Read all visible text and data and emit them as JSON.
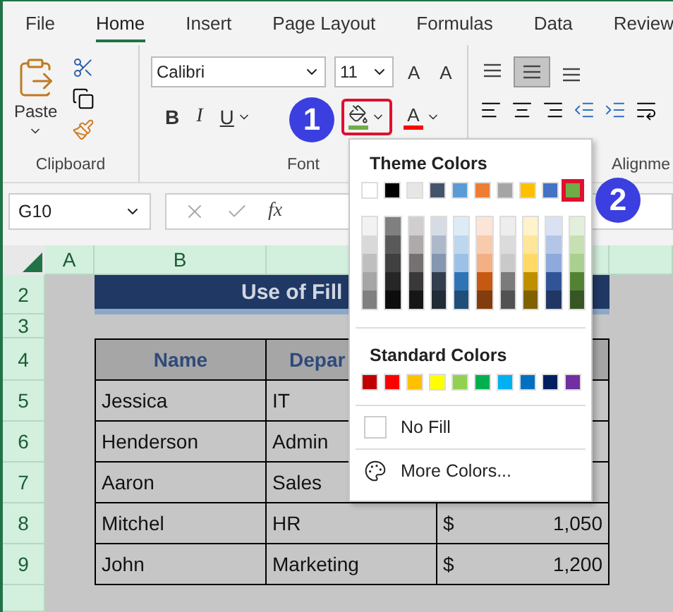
{
  "tabs": [
    {
      "label": "File",
      "selected": false
    },
    {
      "label": "Home",
      "selected": true
    },
    {
      "label": "Insert",
      "selected": false
    },
    {
      "label": "Page Layout",
      "selected": false
    },
    {
      "label": "Formulas",
      "selected": false
    },
    {
      "label": "Data",
      "selected": false
    },
    {
      "label": "Review",
      "selected": false
    }
  ],
  "clipboard": {
    "paste_label": "Paste",
    "group_label": "Clipboard"
  },
  "font": {
    "name": "Calibri",
    "size": "11",
    "grow": "A",
    "shrink": "A",
    "bold": "B",
    "italic": "I",
    "underline": "U",
    "font_color_letter": "A",
    "group_label": "Font"
  },
  "alignment": {
    "group_label": "Alignme"
  },
  "formula_bar": {
    "name_box": "G10",
    "fx": "fx"
  },
  "sheet": {
    "columns": [
      "A",
      "B"
    ],
    "row_numbers": [
      "2",
      "3",
      "4",
      "5",
      "6",
      "7",
      "8",
      "9"
    ],
    "title": "Use of Fill",
    "header": [
      "Name",
      "Depar"
    ],
    "rows": [
      [
        "Jessica",
        "IT"
      ],
      [
        "Henderson",
        "Admin"
      ],
      [
        "Aaron",
        "Sales"
      ],
      [
        "Mitchel",
        "HR",
        "$",
        "1,050"
      ],
      [
        "John",
        "Marketing",
        "$",
        "1,200"
      ]
    ]
  },
  "fill_menu": {
    "theme_title": "Theme Colors",
    "theme_colors": [
      {
        "color": "#ffffff",
        "selected": false,
        "tints": [
          {
            "color": "#f2f2f2"
          },
          {
            "color": "#d9d9d9"
          },
          {
            "color": "#bfbfbf"
          },
          {
            "color": "#a6a6a6"
          },
          {
            "color": "#808080"
          }
        ]
      },
      {
        "color": "#000000",
        "selected": false,
        "tints": [
          {
            "color": "#808080"
          },
          {
            "color": "#595959"
          },
          {
            "color": "#404040"
          },
          {
            "color": "#262626"
          },
          {
            "color": "#0d0d0d"
          }
        ]
      },
      {
        "color": "#e7e6e6",
        "selected": false,
        "tints": [
          {
            "color": "#d0cece"
          },
          {
            "color": "#aeaaaa"
          },
          {
            "color": "#757171"
          },
          {
            "color": "#3a3838"
          },
          {
            "color": "#171616"
          }
        ]
      },
      {
        "color": "#44546a",
        "selected": false,
        "tints": [
          {
            "color": "#d6dce4"
          },
          {
            "color": "#adb9ca"
          },
          {
            "color": "#8496b0"
          },
          {
            "color": "#333f4f"
          },
          {
            "color": "#222a35"
          }
        ]
      },
      {
        "color": "#5b9bd5",
        "selected": false,
        "tints": [
          {
            "color": "#ddebf7"
          },
          {
            "color": "#bdd7ee"
          },
          {
            "color": "#9bc2e6"
          },
          {
            "color": "#2f75b5"
          },
          {
            "color": "#1f4e78"
          }
        ]
      },
      {
        "color": "#ed7d31",
        "selected": false,
        "tints": [
          {
            "color": "#fce4d6"
          },
          {
            "color": "#f8cbad"
          },
          {
            "color": "#f4b084"
          },
          {
            "color": "#c65911"
          },
          {
            "color": "#833c0c"
          }
        ]
      },
      {
        "color": "#a5a5a5",
        "selected": false,
        "tints": [
          {
            "color": "#ededed"
          },
          {
            "color": "#dbdbdb"
          },
          {
            "color": "#c9c9c9"
          },
          {
            "color": "#7b7b7b"
          },
          {
            "color": "#525252"
          }
        ]
      },
      {
        "color": "#ffc000",
        "selected": false,
        "tints": [
          {
            "color": "#fff2cc"
          },
          {
            "color": "#ffe699"
          },
          {
            "color": "#ffd966"
          },
          {
            "color": "#bf8f00"
          },
          {
            "color": "#806000"
          }
        ]
      },
      {
        "color": "#4472c4",
        "selected": false,
        "tints": [
          {
            "color": "#d9e1f2"
          },
          {
            "color": "#b4c6e7"
          },
          {
            "color": "#8ea9db"
          },
          {
            "color": "#305496"
          },
          {
            "color": "#203764"
          }
        ]
      },
      {
        "color": "#70ad47",
        "selected": true,
        "tints": [
          {
            "color": "#e2efda"
          },
          {
            "color": "#c6e0b4"
          },
          {
            "color": "#a9d08e"
          },
          {
            "color": "#548235"
          },
          {
            "color": "#375623"
          }
        ]
      }
    ],
    "standard_title": "Standard Colors",
    "standard_colors": [
      {
        "color": "#c00000"
      },
      {
        "color": "#ff0000"
      },
      {
        "color": "#ffc000"
      },
      {
        "color": "#ffff00"
      },
      {
        "color": "#92d050"
      },
      {
        "color": "#00b050"
      },
      {
        "color": "#00b0f0"
      },
      {
        "color": "#0070c0"
      },
      {
        "color": "#002060"
      },
      {
        "color": "#7030a0"
      }
    ],
    "no_fill": "No Fill",
    "more_colors": "More Colors..."
  },
  "annotations": [
    {
      "label": "1"
    },
    {
      "label": "2"
    }
  ]
}
